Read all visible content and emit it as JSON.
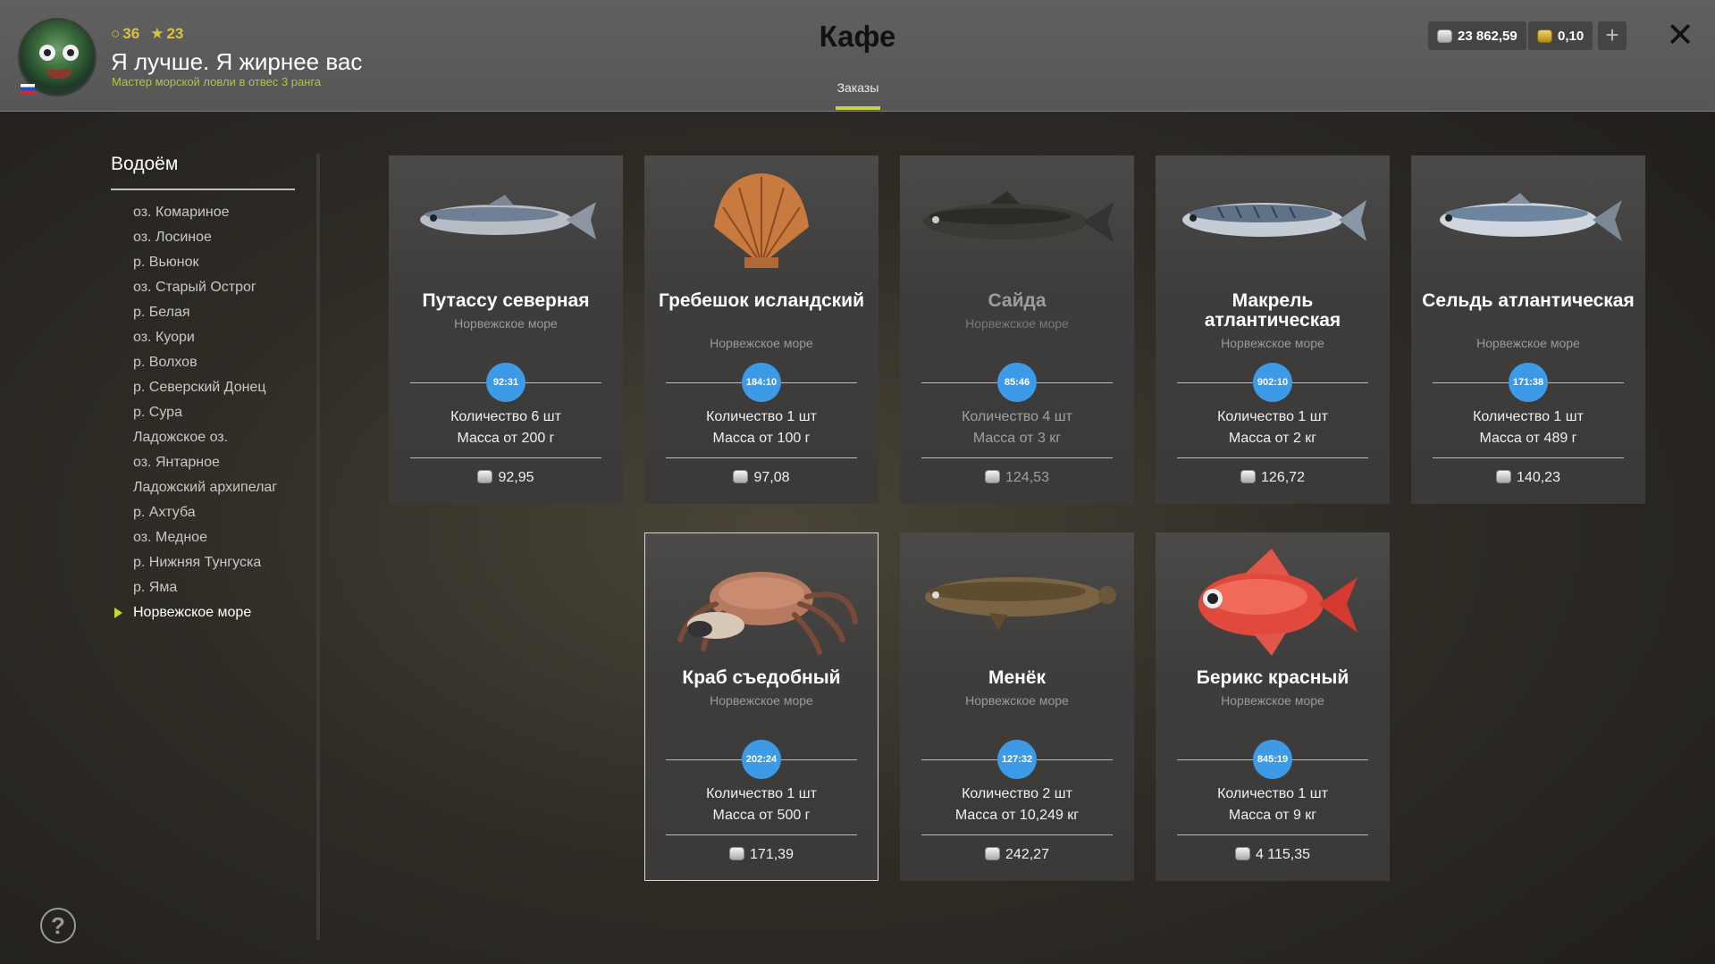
{
  "header": {
    "player": {
      "level": "36",
      "stars": "23",
      "name": "Я лучше. Я жирнее вас",
      "rank": "Мастер морской ловли в отвес 3 ранга"
    },
    "title": "Кафе",
    "tab_label": "Заказы",
    "silver_balance": "23 862,59",
    "gold_balance": "0,10",
    "plus_label": "+",
    "close_label": "✕"
  },
  "sidebar": {
    "title": "Водоём",
    "items": [
      "оз. Комариное",
      "оз. Лосиное",
      "р. Вьюнок",
      "оз. Старый Острог",
      "р. Белая",
      "оз. Куори",
      "р. Волхов",
      "р. Северский Донец",
      "р. Сура",
      "Ладожское оз.",
      "оз. Янтарное",
      "Ладожский архипелаг",
      "р. Ахтуба",
      "оз. Медное",
      "р. Нижняя Тунгуска",
      "р. Яма",
      "Норвежское море"
    ],
    "active_index": 16,
    "help_label": "?"
  },
  "orders": [
    {
      "name": "Путассу северная",
      "area": "Норвежское море",
      "timer": "92:31",
      "qty": "Количество 6 шт",
      "mass": "Масса от 200 г",
      "price": "92,95",
      "icon": "fish-blue-whiting-icon"
    },
    {
      "name": "Гребешок исландский",
      "area": "Норвежское море",
      "timer": "184:10",
      "qty": "Количество 1 шт",
      "mass": "Масса от 100 г",
      "price": "97,08",
      "icon": "scallop-icon"
    },
    {
      "name": "Сайда",
      "area": "Норвежское море",
      "timer": "85:46",
      "qty": "Количество 4 шт",
      "mass": "Масса от 3 кг",
      "price": "124,53",
      "icon": "fish-pollock-icon"
    },
    {
      "name": "Макрель атлантическая",
      "area": "Норвежское море",
      "timer": "902:10",
      "qty": "Количество 1 шт",
      "mass": "Масса от 2 кг",
      "price": "126,72",
      "icon": "fish-mackerel-icon"
    },
    {
      "name": "Сельдь атлантическая",
      "area": "Норвежское море",
      "timer": "171:38",
      "qty": "Количество 1 шт",
      "mass": "Масса от 489 г",
      "price": "140,23",
      "icon": "fish-herring-icon"
    },
    {
      "name": "Краб съедобный",
      "area": "Норвежское море",
      "timer": "202:24",
      "qty": "Количество 1 шт",
      "mass": "Масса от 500 г",
      "price": "171,39",
      "icon": "crab-icon"
    },
    {
      "name": "Менёк",
      "area": "Норвежское море",
      "timer": "127:32",
      "qty": "Количество 2 шт",
      "mass": "Масса от 10,249 кг",
      "price": "242,27",
      "icon": "fish-tusk-icon"
    },
    {
      "name": "Берикс красный",
      "area": "Норвежское море",
      "timer": "845:19",
      "qty": "Количество 1 шт",
      "mass": "Масса от 9 кг",
      "price": "4 115,35",
      "icon": "fish-red-alfonsino-icon"
    }
  ],
  "colors": {
    "accent": "#c8d23a",
    "timer": "#3d9ae6",
    "header_bg": "#5c5c5c"
  }
}
